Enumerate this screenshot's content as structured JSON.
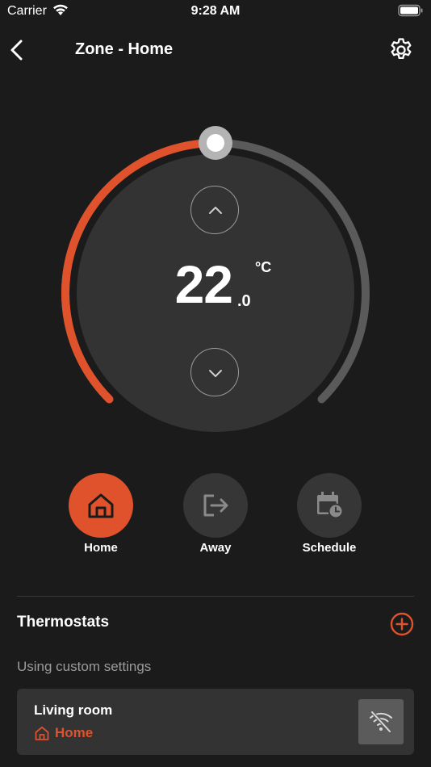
{
  "status_bar": {
    "carrier": "Carrier",
    "time": "9:28 AM"
  },
  "nav": {
    "title": "Zone - Home",
    "back_icon": "chevron-left-icon",
    "settings_icon": "gear-icon"
  },
  "thermostat": {
    "temperature_integer": "22",
    "temperature_decimal": ".0",
    "unit": "°C",
    "dial_level_percent": 50
  },
  "modes": {
    "home_label": "Home",
    "away_label": "Away",
    "schedule_label": "Schedule",
    "selected": "home"
  },
  "thermostats_section": {
    "title": "Thermostats",
    "subtitle": "Using custom settings",
    "add_icon": "plus-circle-icon"
  },
  "devices": [
    {
      "name": "Living room",
      "mode": "Home",
      "connectivity_icon": "wifi-off-icon"
    }
  ],
  "colors": {
    "background": "#1b1b1b",
    "accent": "#e0522b",
    "track": "#5a5a5a",
    "dial_face": "#333333",
    "mode_inactive": "#363636",
    "subtle_text": "#9b9b9b"
  }
}
